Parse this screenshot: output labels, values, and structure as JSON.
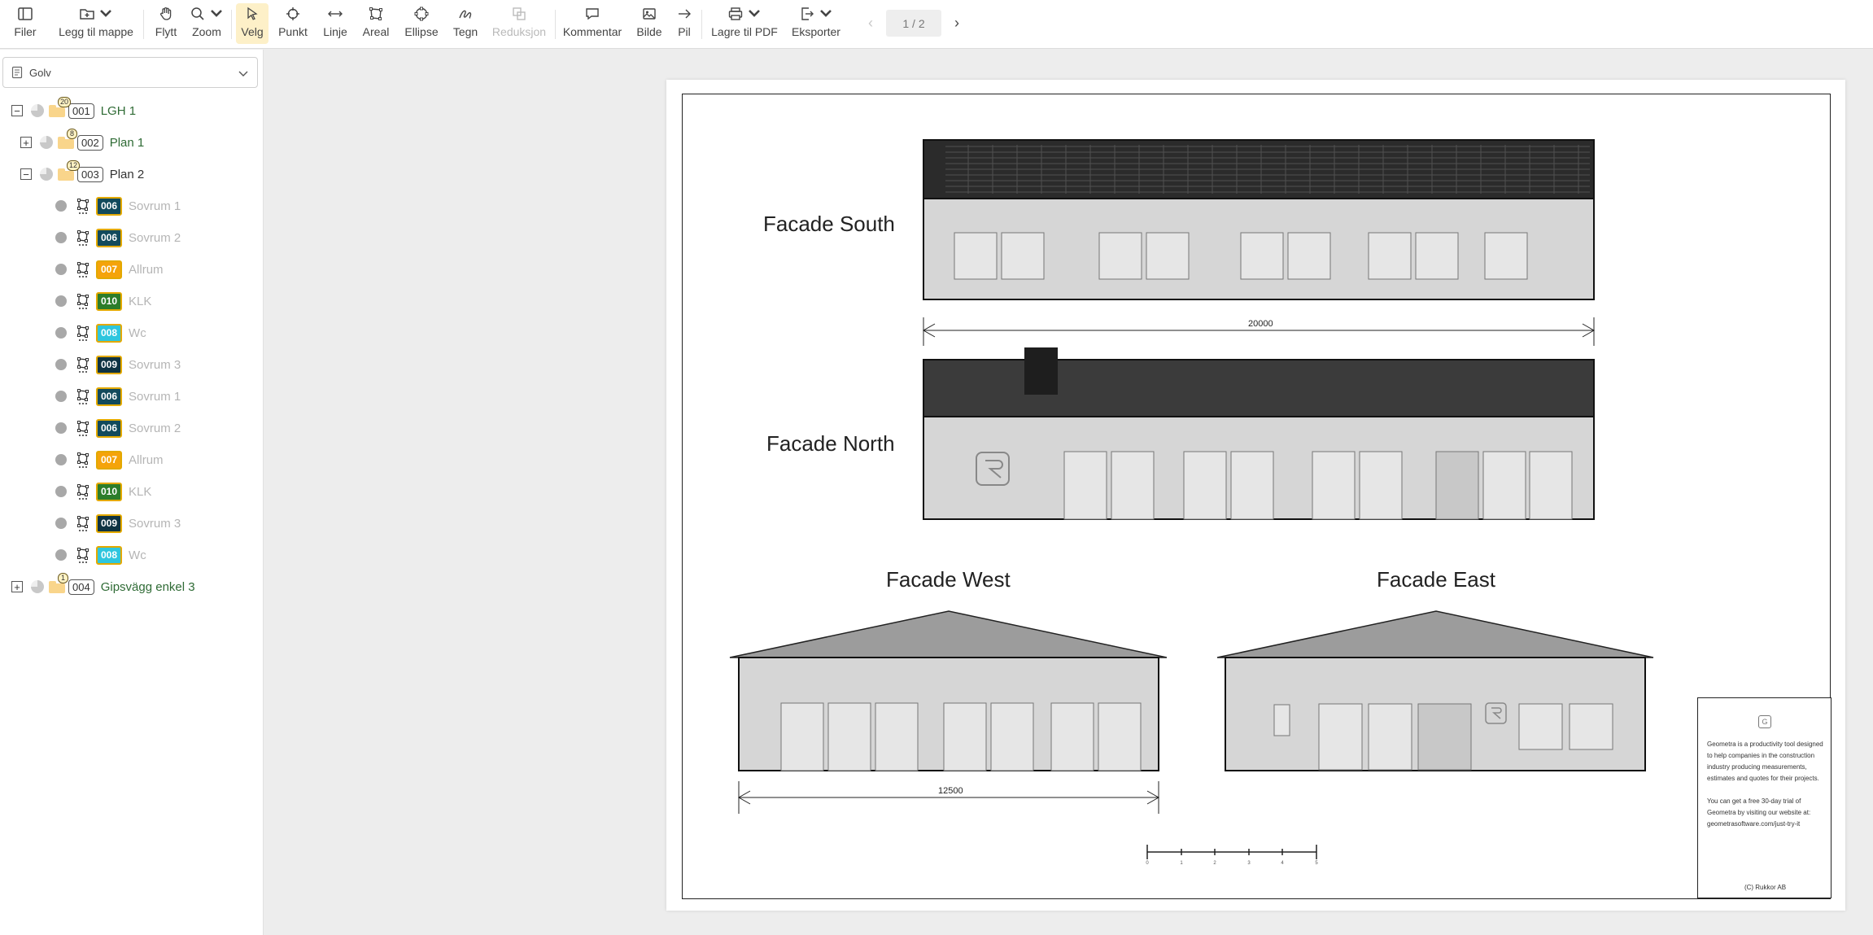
{
  "toolbar": {
    "buttons": [
      {
        "key": "files",
        "label": "Filer",
        "icon": "sidebar-panel-icon"
      },
      {
        "key": "add_to_folder",
        "label": "Legg til mappe",
        "icon": "folder-plus-icon"
      },
      {
        "key": "move",
        "label": "Flytt",
        "icon": "hand-icon"
      },
      {
        "key": "zoom",
        "label": "Zoom",
        "icon": "magnifier-icon"
      },
      {
        "key": "select",
        "label": "Velg",
        "icon": "cursor-arrow-icon"
      },
      {
        "key": "point",
        "label": "Punkt",
        "icon": "crosshair-icon"
      },
      {
        "key": "line",
        "label": "Linje",
        "icon": "double-arrow-icon"
      },
      {
        "key": "area",
        "label": "Areal",
        "icon": "polygon-icon"
      },
      {
        "key": "ellipse",
        "label": "Ellipse",
        "icon": "ellipse-icon"
      },
      {
        "key": "draw",
        "label": "Tegn",
        "icon": "pen-squiggle-icon"
      },
      {
        "key": "reduction",
        "label": "Reduksjon",
        "icon": "reduction-icon"
      },
      {
        "key": "comment",
        "label": "Kommentar",
        "icon": "speech-bubble-icon"
      },
      {
        "key": "image",
        "label": "Bilde",
        "icon": "image-icon"
      },
      {
        "key": "arrow",
        "label": "Pil",
        "icon": "arrow-right-icon"
      },
      {
        "key": "save_pdf",
        "label": "Lagre til PDF",
        "icon": "printer-icon"
      },
      {
        "key": "export",
        "label": "Eksporter",
        "icon": "export-icon"
      }
    ],
    "active_tool": "Velg",
    "disabled_tool": "Reduksjon",
    "page_indicator": "1 / 2"
  },
  "sidebar": {
    "selected_layer": "Golv",
    "tree": {
      "root": {
        "code": "001",
        "name": "LGH 1",
        "count": "20",
        "expanded": true
      },
      "plan1": {
        "code": "002",
        "name": "Plan 1",
        "count": "8",
        "expanded": false
      },
      "plan2": {
        "code": "003",
        "name": "Plan 2",
        "count": "12",
        "expanded": true
      },
      "items": [
        {
          "code": "006",
          "name": "Sovrum 1",
          "color": "#124a5c"
        },
        {
          "code": "006",
          "name": "Sovrum 2",
          "color": "#124a5c"
        },
        {
          "code": "007",
          "name": "Allrum",
          "color": "#f5a30a"
        },
        {
          "code": "010",
          "name": "KLK",
          "color": "#2c7d2a"
        },
        {
          "code": "008",
          "name": "Wc",
          "color": "#2ec6de"
        },
        {
          "code": "009",
          "name": "Sovrum 3",
          "color": "#0f3342"
        },
        {
          "code": "006",
          "name": "Sovrum 1",
          "color": "#124a5c"
        },
        {
          "code": "006",
          "name": "Sovrum 2",
          "color": "#124a5c"
        },
        {
          "code": "007",
          "name": "Allrum",
          "color": "#f5a30a"
        },
        {
          "code": "010",
          "name": "KLK",
          "color": "#2c7d2a"
        },
        {
          "code": "009",
          "name": "Sovrum 3",
          "color": "#0f3342"
        },
        {
          "code": "008",
          "name": "Wc",
          "color": "#2ec6de"
        }
      ],
      "last": {
        "code": "004",
        "name": "Gipsvägg enkel 3",
        "count": "1",
        "expanded": false
      }
    }
  },
  "drawing": {
    "facade_south": "Facade South",
    "facade_north": "Facade North",
    "facade_west": "Facade West",
    "facade_east": "Facade East",
    "dim_south": "20000",
    "dim_west": "12500",
    "scale_ticks": [
      "0",
      "1",
      "2",
      "3",
      "4",
      "5"
    ],
    "title_block": {
      "logo": "G",
      "text1": "Geometra is a productivity tool designed to help companies in the construction industry producing measurements, estimates and quotes for their projects.",
      "text2": "You can get a free 30-day trial of Geometra by visiting our website at: geometrasoftware.com/just-try-it",
      "copyright": "(C) Rukkor AB"
    }
  }
}
